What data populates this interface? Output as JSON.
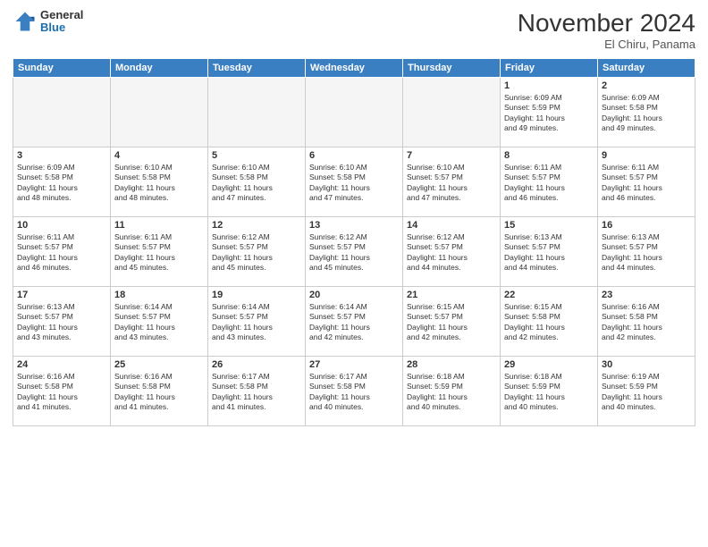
{
  "header": {
    "logo_general": "General",
    "logo_blue": "Blue",
    "month_title": "November 2024",
    "location": "El Chiru, Panama"
  },
  "weekdays": [
    "Sunday",
    "Monday",
    "Tuesday",
    "Wednesday",
    "Thursday",
    "Friday",
    "Saturday"
  ],
  "weeks": [
    [
      {
        "day": "",
        "info": "",
        "empty": true
      },
      {
        "day": "",
        "info": "",
        "empty": true
      },
      {
        "day": "",
        "info": "",
        "empty": true
      },
      {
        "day": "",
        "info": "",
        "empty": true
      },
      {
        "day": "",
        "info": "",
        "empty": true
      },
      {
        "day": "1",
        "info": "Sunrise: 6:09 AM\nSunset: 5:59 PM\nDaylight: 11 hours\nand 49 minutes."
      },
      {
        "day": "2",
        "info": "Sunrise: 6:09 AM\nSunset: 5:58 PM\nDaylight: 11 hours\nand 49 minutes."
      }
    ],
    [
      {
        "day": "3",
        "info": "Sunrise: 6:09 AM\nSunset: 5:58 PM\nDaylight: 11 hours\nand 48 minutes."
      },
      {
        "day": "4",
        "info": "Sunrise: 6:10 AM\nSunset: 5:58 PM\nDaylight: 11 hours\nand 48 minutes."
      },
      {
        "day": "5",
        "info": "Sunrise: 6:10 AM\nSunset: 5:58 PM\nDaylight: 11 hours\nand 47 minutes."
      },
      {
        "day": "6",
        "info": "Sunrise: 6:10 AM\nSunset: 5:58 PM\nDaylight: 11 hours\nand 47 minutes."
      },
      {
        "day": "7",
        "info": "Sunrise: 6:10 AM\nSunset: 5:57 PM\nDaylight: 11 hours\nand 47 minutes."
      },
      {
        "day": "8",
        "info": "Sunrise: 6:11 AM\nSunset: 5:57 PM\nDaylight: 11 hours\nand 46 minutes."
      },
      {
        "day": "9",
        "info": "Sunrise: 6:11 AM\nSunset: 5:57 PM\nDaylight: 11 hours\nand 46 minutes."
      }
    ],
    [
      {
        "day": "10",
        "info": "Sunrise: 6:11 AM\nSunset: 5:57 PM\nDaylight: 11 hours\nand 46 minutes."
      },
      {
        "day": "11",
        "info": "Sunrise: 6:11 AM\nSunset: 5:57 PM\nDaylight: 11 hours\nand 45 minutes."
      },
      {
        "day": "12",
        "info": "Sunrise: 6:12 AM\nSunset: 5:57 PM\nDaylight: 11 hours\nand 45 minutes."
      },
      {
        "day": "13",
        "info": "Sunrise: 6:12 AM\nSunset: 5:57 PM\nDaylight: 11 hours\nand 45 minutes."
      },
      {
        "day": "14",
        "info": "Sunrise: 6:12 AM\nSunset: 5:57 PM\nDaylight: 11 hours\nand 44 minutes."
      },
      {
        "day": "15",
        "info": "Sunrise: 6:13 AM\nSunset: 5:57 PM\nDaylight: 11 hours\nand 44 minutes."
      },
      {
        "day": "16",
        "info": "Sunrise: 6:13 AM\nSunset: 5:57 PM\nDaylight: 11 hours\nand 44 minutes."
      }
    ],
    [
      {
        "day": "17",
        "info": "Sunrise: 6:13 AM\nSunset: 5:57 PM\nDaylight: 11 hours\nand 43 minutes."
      },
      {
        "day": "18",
        "info": "Sunrise: 6:14 AM\nSunset: 5:57 PM\nDaylight: 11 hours\nand 43 minutes."
      },
      {
        "day": "19",
        "info": "Sunrise: 6:14 AM\nSunset: 5:57 PM\nDaylight: 11 hours\nand 43 minutes."
      },
      {
        "day": "20",
        "info": "Sunrise: 6:14 AM\nSunset: 5:57 PM\nDaylight: 11 hours\nand 42 minutes."
      },
      {
        "day": "21",
        "info": "Sunrise: 6:15 AM\nSunset: 5:57 PM\nDaylight: 11 hours\nand 42 minutes."
      },
      {
        "day": "22",
        "info": "Sunrise: 6:15 AM\nSunset: 5:58 PM\nDaylight: 11 hours\nand 42 minutes."
      },
      {
        "day": "23",
        "info": "Sunrise: 6:16 AM\nSunset: 5:58 PM\nDaylight: 11 hours\nand 42 minutes."
      }
    ],
    [
      {
        "day": "24",
        "info": "Sunrise: 6:16 AM\nSunset: 5:58 PM\nDaylight: 11 hours\nand 41 minutes."
      },
      {
        "day": "25",
        "info": "Sunrise: 6:16 AM\nSunset: 5:58 PM\nDaylight: 11 hours\nand 41 minutes."
      },
      {
        "day": "26",
        "info": "Sunrise: 6:17 AM\nSunset: 5:58 PM\nDaylight: 11 hours\nand 41 minutes."
      },
      {
        "day": "27",
        "info": "Sunrise: 6:17 AM\nSunset: 5:58 PM\nDaylight: 11 hours\nand 40 minutes."
      },
      {
        "day": "28",
        "info": "Sunrise: 6:18 AM\nSunset: 5:59 PM\nDaylight: 11 hours\nand 40 minutes."
      },
      {
        "day": "29",
        "info": "Sunrise: 6:18 AM\nSunset: 5:59 PM\nDaylight: 11 hours\nand 40 minutes."
      },
      {
        "day": "30",
        "info": "Sunrise: 6:19 AM\nSunset: 5:59 PM\nDaylight: 11 hours\nand 40 minutes."
      }
    ]
  ]
}
